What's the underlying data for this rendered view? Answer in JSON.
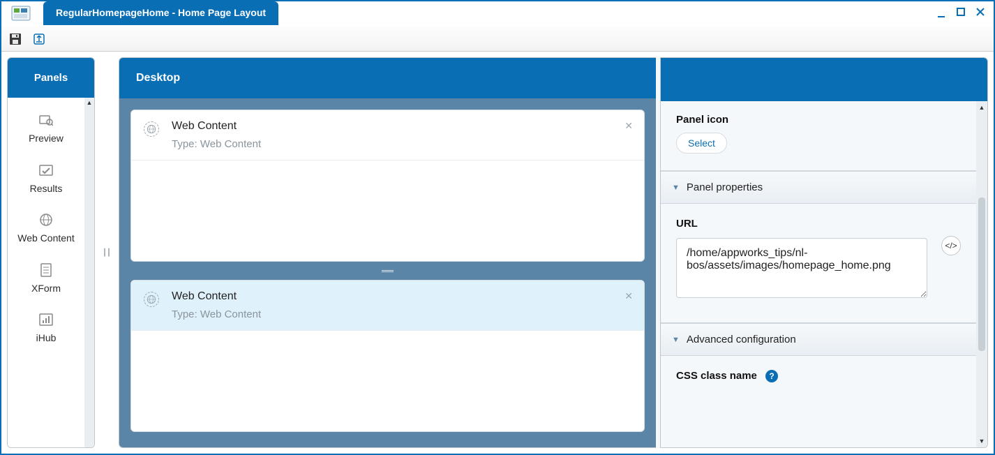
{
  "window": {
    "tab_title": "RegularHomepageHome - Home Page Layout"
  },
  "sidebar": {
    "header": "Panels",
    "items": [
      {
        "label": "Preview"
      },
      {
        "label": "Results"
      },
      {
        "label": "Web Content"
      },
      {
        "label": "XForm"
      },
      {
        "label": "iHub"
      }
    ]
  },
  "canvas": {
    "header": "Desktop",
    "panels": [
      {
        "title": "Web Content",
        "subtitle": "Type: Web Content",
        "selected": false
      },
      {
        "title": "Web Content",
        "subtitle": "Type: Web Content",
        "selected": true
      }
    ]
  },
  "props": {
    "panel_icon": {
      "label": "Panel icon",
      "select_btn": "Select"
    },
    "section_properties": "Panel properties",
    "url": {
      "label": "URL",
      "value": "/home/appworks_tips/nl-bos/assets/images/homepage_home.png"
    },
    "section_advanced": "Advanced configuration",
    "css": {
      "label": "CSS class name"
    }
  }
}
